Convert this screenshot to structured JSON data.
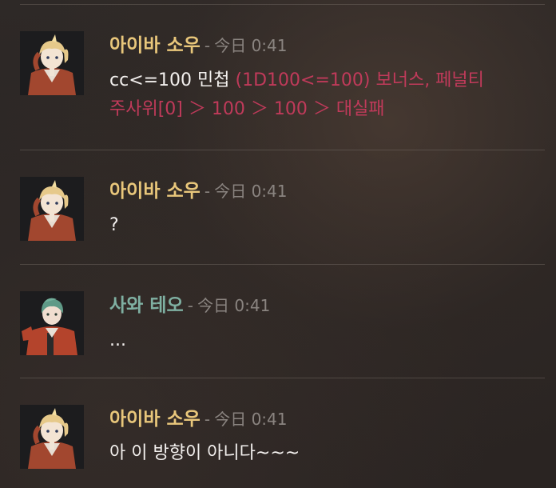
{
  "messages": [
    {
      "author": "아이바 소우",
      "separator": "-",
      "time": "今日 0:41",
      "text_main": "cc<=100 민첩 ",
      "text_dice_line1": "(1D100<=100) 보너스, 페널티",
      "text_dice_line2": "주사위[0] ＞ 100 ＞ 100 ＞ 대실패"
    },
    {
      "author": "아이바 소우",
      "separator": "-",
      "time": "今日 0:41",
      "text": "?"
    },
    {
      "author": "사와 테오",
      "separator": "-",
      "time": "今日 0:41",
      "text": "..."
    },
    {
      "author": "아이바 소우",
      "separator": "-",
      "time": "今日 0:41",
      "text": "아 이 방향이 아니다~~~"
    }
  ],
  "colors": {
    "author_gold": "#e9c77b",
    "author_teal": "#7fb0a2",
    "dice_result": "#c03a5a",
    "timestamp": "#8a8480"
  }
}
